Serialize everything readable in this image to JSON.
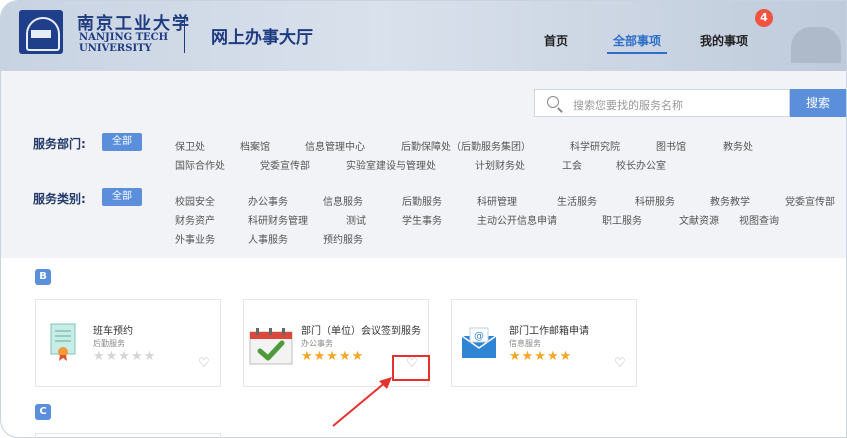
{
  "header": {
    "university_cn": "南京工业大学",
    "university_en": "NANJING TECH\nUNIVERSITY",
    "hall_title": "网上办事大厅",
    "nav": [
      "首页",
      "全部事项",
      "我的事项"
    ],
    "active_nav": "全部事项",
    "badge_count": "4"
  },
  "search": {
    "placeholder": "搜索您要找的服务名称",
    "button": "搜索"
  },
  "filters": {
    "dept_label": "服务部门:",
    "dept_all": "全部",
    "dept_row1": [
      "保卫处",
      "档案馆",
      "信息管理中心",
      "后勤保障处（后勤服务集团）",
      "科学研究院",
      "图书馆",
      "教务处"
    ],
    "dept_row2": [
      "国际合作处",
      "党委宣传部",
      "实验室建设与管理处",
      "计划财务处",
      "工会",
      "校长办公室"
    ],
    "cat_label": "服务类别:",
    "cat_all": "全部",
    "cat_row1": [
      "校园安全",
      "办公事务",
      "信息服务",
      "后勤服务",
      "科研管理",
      "生活服务",
      "科研服务",
      "教务教学",
      "党委宣传部"
    ],
    "cat_row2": [
      "财务资产",
      "科研财务管理",
      "测试",
      "学生事务",
      "主动公开信息申请",
      "职工服务",
      "文献资源",
      "视图查询"
    ],
    "cat_row3": [
      "外事业务",
      "人事服务",
      "预约服务"
    ]
  },
  "sections": [
    {
      "letter": "B",
      "cards": [
        {
          "name": "班车预约",
          "category": "后勤服务",
          "rating": 0
        },
        {
          "name": "部门（单位）会议签到服务",
          "category": "办公事务",
          "rating": 5
        },
        {
          "name": "部门工作邮箱申请",
          "category": "信息服务",
          "rating": 5
        }
      ]
    },
    {
      "letter": "C",
      "cards": []
    }
  ],
  "colors": {
    "accent": "#5b8fdc",
    "star_filled": "#f5a623",
    "star_empty": "#d5d5d5",
    "highlight": "#e5322d"
  }
}
